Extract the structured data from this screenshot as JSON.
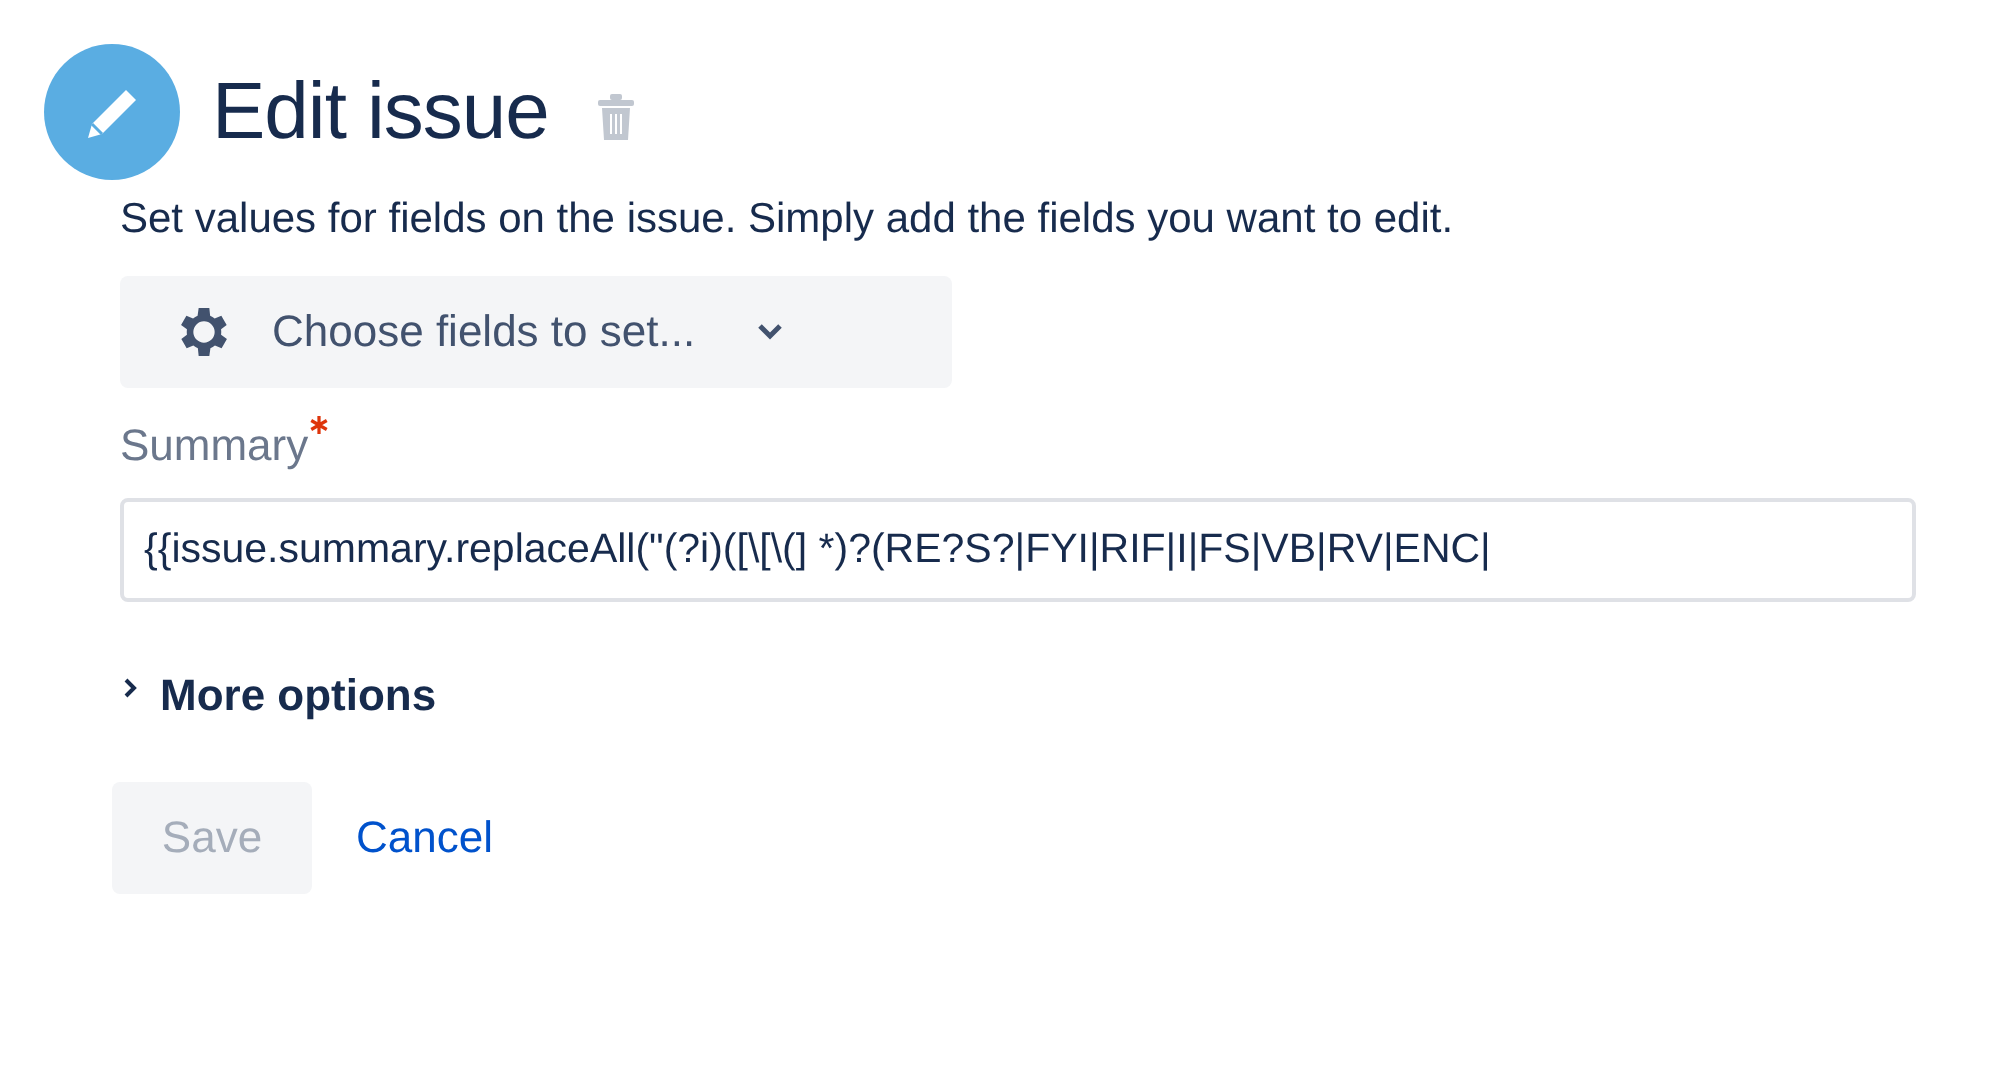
{
  "header": {
    "title": "Edit issue"
  },
  "description": "Set values for fields on the issue. Simply add the fields you want to edit.",
  "fields_dropdown": {
    "label": "Choose fields to set..."
  },
  "summary": {
    "label": "Summary",
    "required": true,
    "value": "{{issue.summary.replaceAll(\"(?i)([\\[\\(] *)?(RE?S?|FYI|RIF|I|FS|VB|RV|ENC|"
  },
  "more_options": {
    "label": "More options",
    "expanded": false
  },
  "buttons": [
    {
      "kind": "primary",
      "label": "Save",
      "disabled": true
    },
    {
      "kind": "link",
      "label": "Cancel",
      "disabled": false
    }
  ]
}
